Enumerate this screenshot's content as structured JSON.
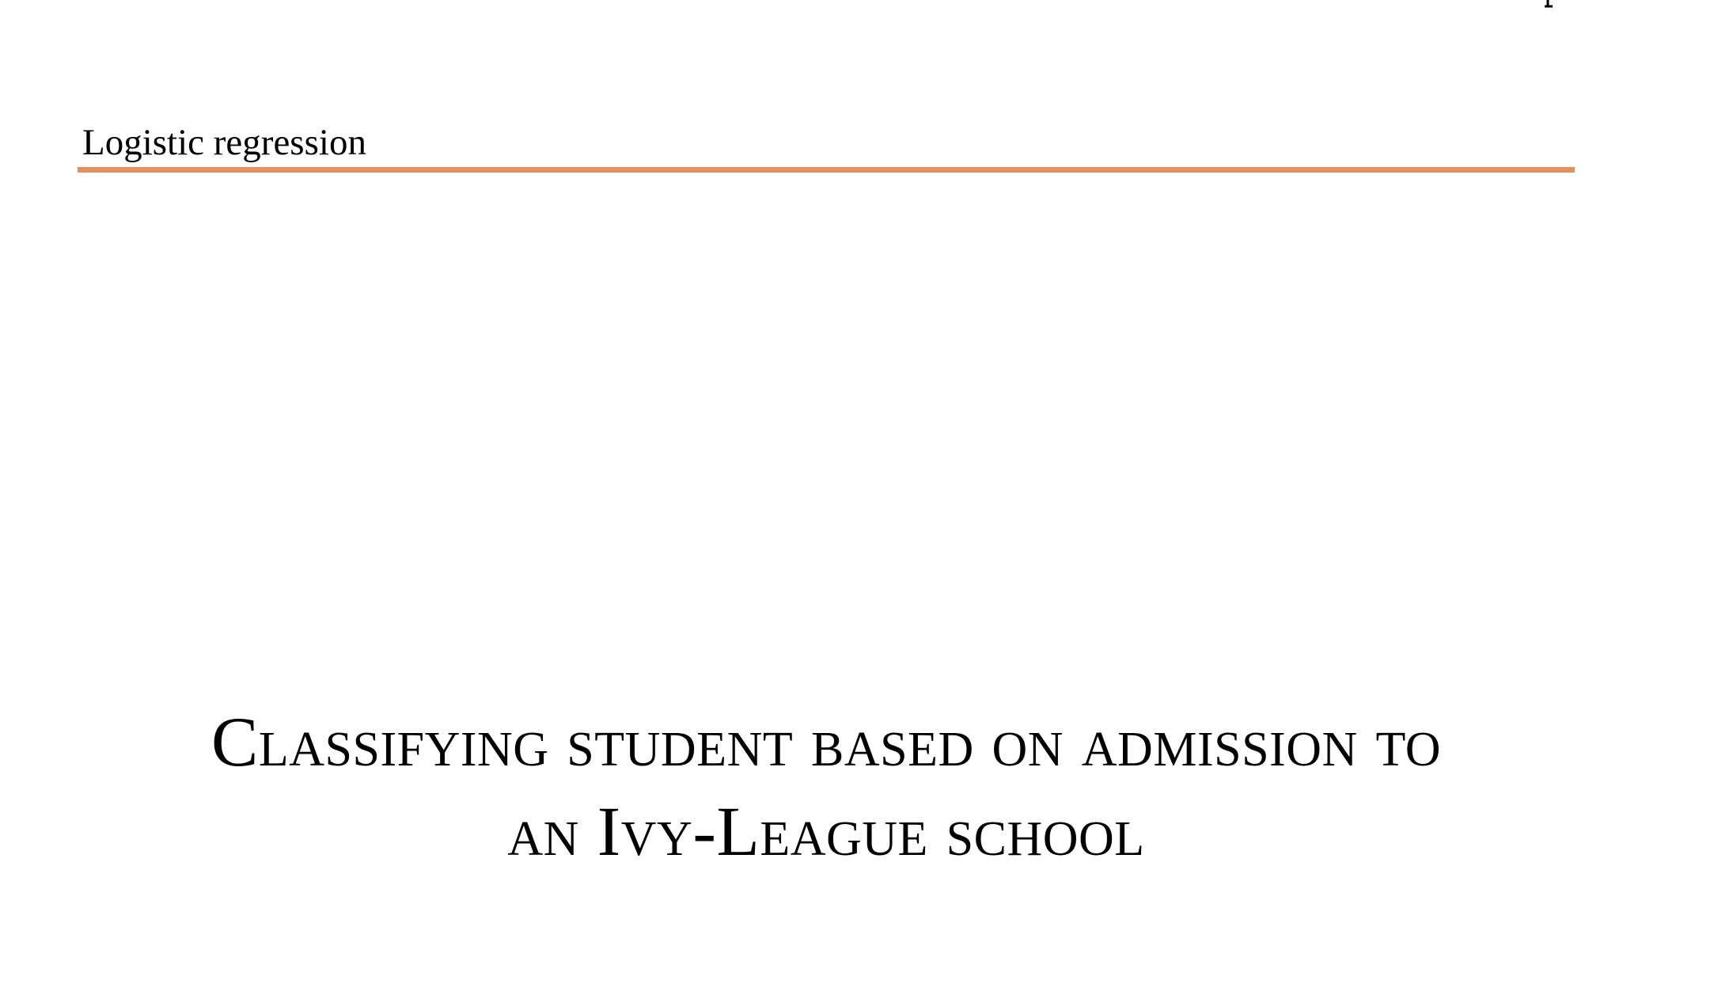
{
  "header": {
    "running_title": "Logistic regression",
    "rule_color": "#e09261"
  },
  "title": {
    "line1": "Classifying student based on admission to",
    "line2": "an Ivy-League school"
  }
}
